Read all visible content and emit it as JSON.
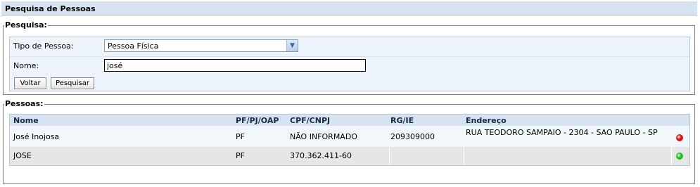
{
  "page": {
    "title": "Pesquisa de Pessoas"
  },
  "search": {
    "legend": "Pesquisa:",
    "tipo_label": "Tipo de Pessoa:",
    "tipo_value": "Pessoa Física",
    "nome_label": "Nome:",
    "nome_value": "josé",
    "voltar_label": "Voltar",
    "pesquisar_label": "Pesquisar"
  },
  "results": {
    "legend": "Pessoas:",
    "headers": {
      "nome": "Nome",
      "tipo": "PF/PJ/OAP",
      "cpf": "CPF/CNPJ",
      "rg": "RG/IE",
      "endereco": "Endereço"
    },
    "rows": [
      {
        "nome": "José Inojosa",
        "tipo": "PF",
        "cpf": "NÃO INFORMADO",
        "rg": "209309000",
        "endereco": "RUA TEODORO SAMPAIO - 2304 - SAO PAULO - SP",
        "status_color": "#e01010"
      },
      {
        "nome": "JOSE",
        "tipo": "PF",
        "cpf": "370.362.411-60",
        "rg": "",
        "endereco": "",
        "status_color": "#1fc01f"
      }
    ]
  }
}
